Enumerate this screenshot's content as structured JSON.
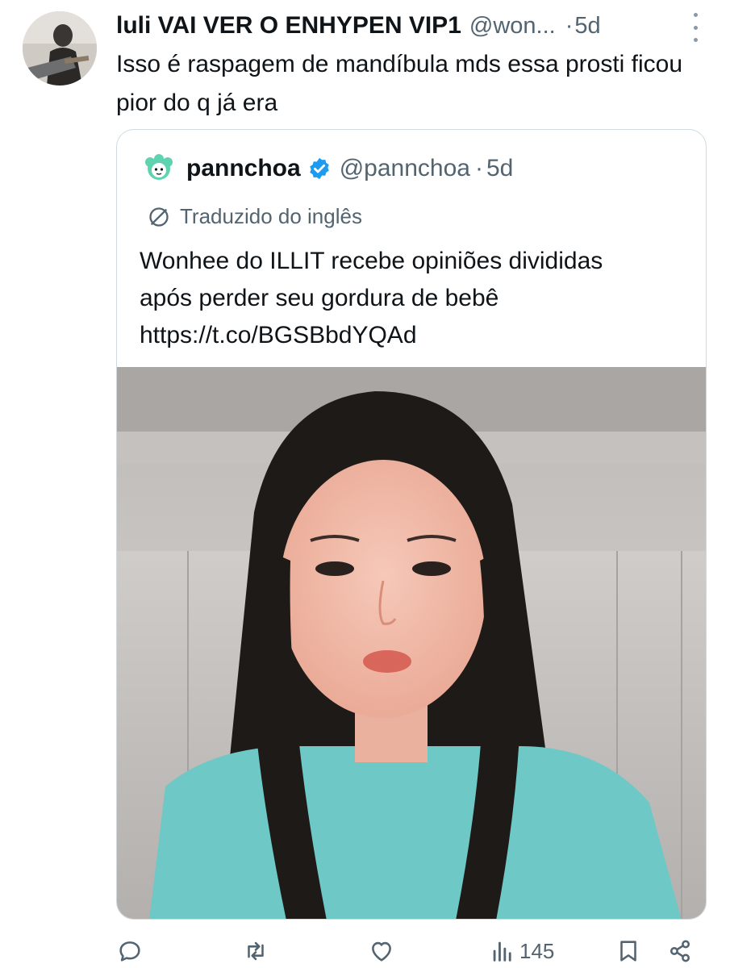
{
  "tweet": {
    "display_name": "luli VAI VER O ENHYPEN VIP1",
    "handle": "@won...",
    "separator": "·",
    "time": "5d",
    "text": "Isso é raspagem de mandíbula mds essa prosti ficou pior do q já era"
  },
  "quoted": {
    "display_name": "pannchoa",
    "handle": "@pannchoa",
    "separator": "·",
    "time": "5d",
    "translated_label": "Traduzido do inglês",
    "text_line1": "Wonhee do ILLIT recebe opiniões divididas",
    "text_line2": "após perder seu gordura de bebê",
    "link": "https://t.co/BGSBbdYQAd",
    "media_alt": "Photo of a young woman with long dark hair in a turquoise shirt"
  },
  "actions": {
    "reply_icon": "reply-icon",
    "retweet_icon": "retweet-icon",
    "like_icon": "heart-icon",
    "views_icon": "views-icon",
    "views_count": "145",
    "bookmark_icon": "bookmark-icon",
    "share_icon": "share-icon"
  },
  "colors": {
    "text": "#0f1419",
    "secondary": "#536471",
    "border": "#cfd9de",
    "verified": "#1d9bf0",
    "mint": "#5fd3b0"
  }
}
